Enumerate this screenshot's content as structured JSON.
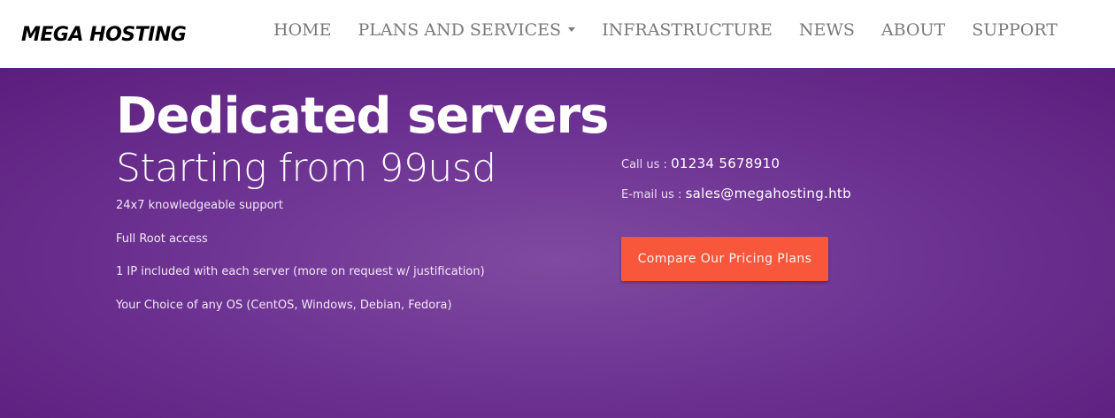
{
  "header": {
    "brand": "MEGA HOSTING",
    "nav": [
      {
        "label": "HOME"
      },
      {
        "label": "PLANS AND SERVICES",
        "has_dropdown": true,
        "icon": "caret-down-icon"
      },
      {
        "label": "INFRASTRUCTURE"
      },
      {
        "label": "NEWS"
      },
      {
        "label": "ABOUT"
      },
      {
        "label": "SUPPORT"
      }
    ]
  },
  "hero": {
    "title": "Dedicated servers",
    "subtitle": "Starting from 99usd",
    "features": [
      "24x7 knowledgeable support",
      "Full Root access",
      "1 IP included with each server (more on request w/ justification)",
      "Your Choice of any OS (CentOS, Windows, Debian, Fedora)"
    ],
    "contact": {
      "phone_label": "Call us : ",
      "phone": "01234 5678910",
      "email_label": "E-mail us : ",
      "email": "sales@megahosting.htb"
    },
    "cta_label": "Compare Our Pricing Plans"
  },
  "colors": {
    "hero_background": "#6e3493",
    "cta_background": "#f8573b",
    "nav_text": "#7a7a7a"
  }
}
